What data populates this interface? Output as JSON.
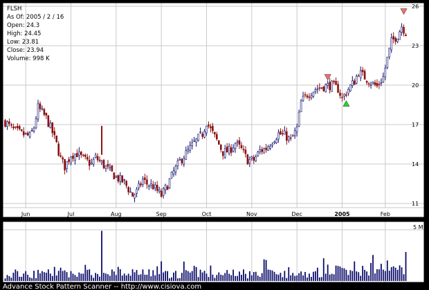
{
  "chart_data": {
    "type": "candlestick",
    "symbol": "FLSH",
    "info": {
      "symbol": "FLSH",
      "as_of": "As Of: 2005 / 2 / 16",
      "open": "Open: 24.3",
      "high": "High: 24.45",
      "low": "Low: 23.81",
      "close": "Close: 23.94",
      "volume": "Volume: 998 K"
    },
    "price_axis": {
      "ticks": [
        11,
        14,
        17,
        20,
        23,
        26
      ],
      "range": [
        11,
        26
      ]
    },
    "volume_axis": {
      "label": "5 M",
      "max_millions": 5
    },
    "time_axis": {
      "labels": [
        "Jun",
        "Jul",
        "Aug",
        "Sep",
        "Oct",
        "Nov",
        "Dec",
        "2005",
        "Feb"
      ],
      "label_day_index": [
        10,
        32,
        54,
        76,
        98,
        120,
        142,
        164,
        185
      ],
      "total_days": 196
    },
    "price_path": [
      [
        0,
        17.2
      ],
      [
        4,
        16.6
      ],
      [
        8,
        16.3
      ],
      [
        12,
        16.1
      ],
      [
        14,
        16.8
      ],
      [
        16,
        18.3
      ],
      [
        20,
        17.5
      ],
      [
        23,
        16.4
      ],
      [
        25,
        15.5
      ],
      [
        27,
        14.4
      ],
      [
        29,
        13.8
      ],
      [
        32,
        14.7
      ],
      [
        35,
        14.8
      ],
      [
        38,
        14.4
      ],
      [
        42,
        14.0
      ],
      [
        44,
        14.5
      ],
      [
        46,
        14.2
      ],
      [
        50,
        13.6
      ],
      [
        54,
        13.0
      ],
      [
        58,
        12.6
      ],
      [
        62,
        11.6
      ],
      [
        64,
        11.9
      ],
      [
        67,
        12.8
      ],
      [
        69,
        12.5
      ],
      [
        72,
        12.3
      ],
      [
        76,
        11.6
      ],
      [
        79,
        12.4
      ],
      [
        82,
        13.4
      ],
      [
        85,
        14.2
      ],
      [
        88,
        14.8
      ],
      [
        92,
        15.6
      ],
      [
        96,
        16.3
      ],
      [
        98,
        17.2
      ],
      [
        100,
        16.6
      ],
      [
        103,
        15.8
      ],
      [
        106,
        14.9
      ],
      [
        109,
        15.0
      ],
      [
        112,
        15.6
      ],
      [
        115,
        15.1
      ],
      [
        118,
        14.3
      ],
      [
        121,
        14.3
      ],
      [
        124,
        15.0
      ],
      [
        127,
        15.2
      ],
      [
        130,
        15.8
      ],
      [
        133,
        16.3
      ],
      [
        136,
        16.2
      ],
      [
        139,
        15.8
      ],
      [
        142,
        16.7
      ],
      [
        144,
        18.7
      ],
      [
        147,
        19.3
      ],
      [
        151,
        19.7
      ],
      [
        155,
        19.9
      ],
      [
        159,
        20.0
      ],
      [
        162,
        19.7
      ],
      [
        164,
        19.0
      ],
      [
        167,
        19.7
      ],
      [
        170,
        20.3
      ],
      [
        172,
        21.0
      ],
      [
        175,
        20.6
      ],
      [
        178,
        20.2
      ],
      [
        181,
        19.9
      ],
      [
        184,
        20.6
      ],
      [
        186,
        22.0
      ],
      [
        188,
        23.3
      ],
      [
        191,
        23.8
      ],
      [
        193,
        24.5
      ],
      [
        195,
        24.0
      ]
    ],
    "volume_spike": {
      "day": 47,
      "millions": 4.9
    },
    "markers": [
      {
        "type": "sell",
        "day": 157,
        "price": 20.6
      },
      {
        "type": "buy",
        "day": 166,
        "price": 18.6
      },
      {
        "type": "sell",
        "day": 194,
        "price": 25.6
      }
    ],
    "colors": {
      "background": "#ffffff",
      "frame": "#000000",
      "grid": "#c8c8c8",
      "up": "#0a0a6a",
      "down": "#8c1010",
      "volume": "#0a0a6a",
      "sell_marker": "#ff6a6a",
      "buy_marker": "#22dd22"
    }
  },
  "footer": "Advance Stock Pattern Scanner -- http://www.cisiova.com"
}
